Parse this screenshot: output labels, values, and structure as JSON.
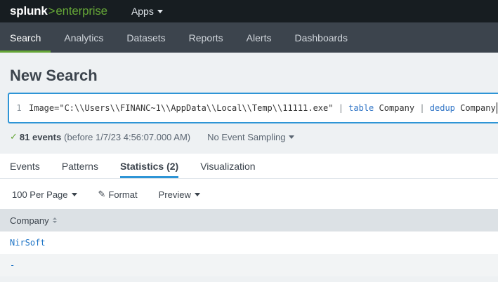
{
  "app": {
    "logo_splunk": "splunk",
    "logo_gt": ">",
    "logo_enterprise": "enterprise",
    "apps_label": "Apps"
  },
  "nav": {
    "items": [
      "Search",
      "Analytics",
      "Datasets",
      "Reports",
      "Alerts",
      "Dashboards"
    ],
    "active": "Search"
  },
  "page": {
    "title": "New Search"
  },
  "search": {
    "line_number": "1",
    "query_part1": "Image=\"C:\\\\Users\\\\FINANC~1\\\\AppData\\\\Local\\\\Temp\\\\11111.exe\" ",
    "pipe1": "|",
    "kw_table": " table",
    "table_arg": " Company ",
    "pipe2": "|",
    "kw_dedup": " dedup",
    "dedup_arg": " Company"
  },
  "status": {
    "check": "✓",
    "events": "81 events",
    "before": "(before 1/7/23 4:56:07.000 AM)",
    "sampling": "No Event Sampling"
  },
  "tabs": {
    "items": [
      "Events",
      "Patterns",
      "Statistics (2)",
      "Visualization"
    ],
    "active": "Statistics (2)"
  },
  "toolbar": {
    "per_page": "100 Per Page",
    "format": "Format",
    "preview": "Preview"
  },
  "table": {
    "header": "Company",
    "rows": [
      "NirSoft",
      "-"
    ]
  },
  "colors": {
    "accent_green": "#65a637",
    "accent_blue": "#2e95d6",
    "nav_bg": "#3c444d",
    "topbar_bg": "#171d21"
  }
}
